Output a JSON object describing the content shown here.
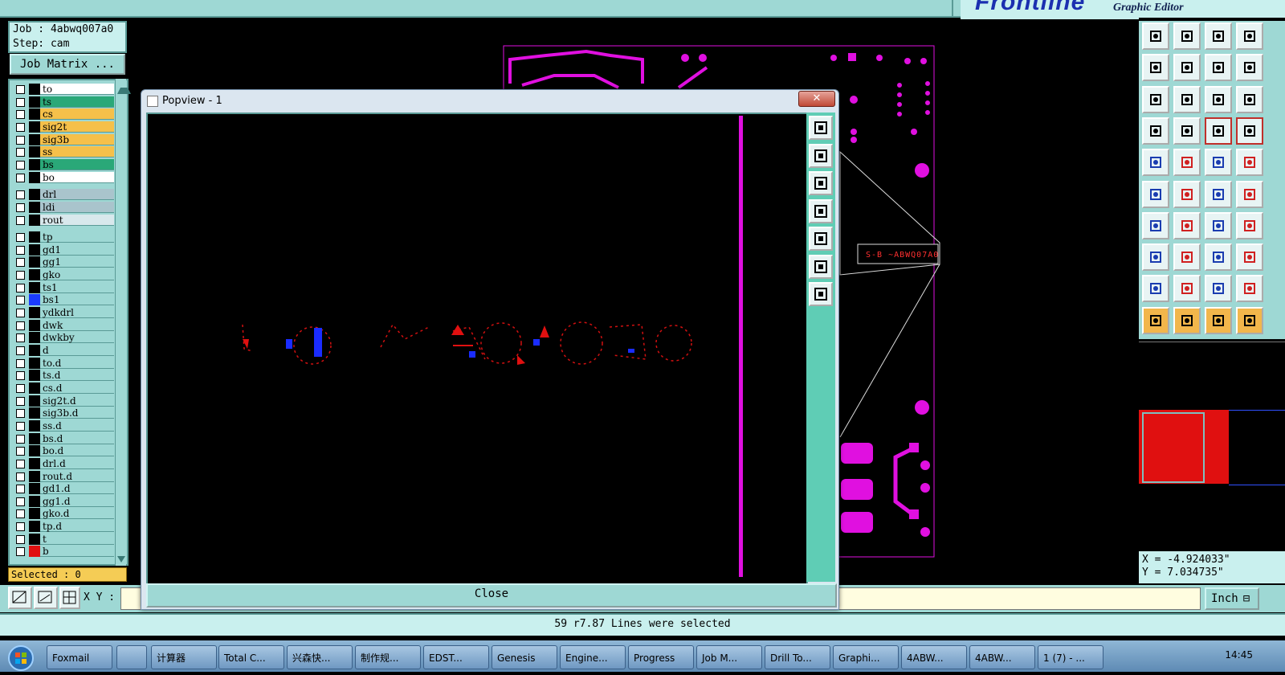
{
  "app": {
    "brand": "Frontline",
    "subtitle": "Graphic Editor"
  },
  "job": {
    "label": "Job : 4abwq007a0",
    "step": "Step: cam",
    "matrix_button": "Job Matrix ..."
  },
  "layers": [
    {
      "name": "to",
      "color": "#ffffff",
      "ind": "#000000"
    },
    {
      "name": "ts",
      "color": "#2aa878",
      "ind": "#000000"
    },
    {
      "name": "cs",
      "color": "#f5c04a",
      "ind": "#000000"
    },
    {
      "name": "sig2t",
      "color": "#f5c04a",
      "ind": "#000000"
    },
    {
      "name": "sig3b",
      "color": "#f5c04a",
      "ind": "#000000"
    },
    {
      "name": "ss",
      "color": "#f5c04a",
      "ind": "#000000"
    },
    {
      "name": "bs",
      "color": "#2aa878",
      "ind": "#000000"
    },
    {
      "name": "bo",
      "color": "#ffffff",
      "ind": "#000000"
    },
    {
      "name": "drl",
      "color": "#a9c4cc",
      "ind": "#000000"
    },
    {
      "name": "ldi",
      "color": "#a9c4cc",
      "ind": "#000000"
    },
    {
      "name": "rout",
      "color": "#d8e8ec",
      "ind": "#000000"
    },
    {
      "name": "tp",
      "color": "#9ed8d4",
      "ind": "#000000"
    },
    {
      "name": "gd1",
      "color": "#9ed8d4",
      "ind": "#000000"
    },
    {
      "name": "gg1",
      "color": "#9ed8d4",
      "ind": "#000000"
    },
    {
      "name": "gko",
      "color": "#9ed8d4",
      "ind": "#000000"
    },
    {
      "name": "ts1",
      "color": "#9ed8d4",
      "ind": "#000000"
    },
    {
      "name": "bs1",
      "color": "#9ed8d4",
      "ind": "#1a3cff"
    },
    {
      "name": "ydkdrl",
      "color": "#9ed8d4",
      "ind": "#000000"
    },
    {
      "name": "dwk",
      "color": "#9ed8d4",
      "ind": "#000000"
    },
    {
      "name": "dwkby",
      "color": "#9ed8d4",
      "ind": "#000000"
    },
    {
      "name": "d",
      "color": "#9ed8d4",
      "ind": "#000000"
    },
    {
      "name": "to.d",
      "color": "#9ed8d4",
      "ind": "#000000"
    },
    {
      "name": "ts.d",
      "color": "#9ed8d4",
      "ind": "#000000"
    },
    {
      "name": "cs.d",
      "color": "#9ed8d4",
      "ind": "#000000"
    },
    {
      "name": "sig2t.d",
      "color": "#9ed8d4",
      "ind": "#000000"
    },
    {
      "name": "sig3b.d",
      "color": "#9ed8d4",
      "ind": "#000000"
    },
    {
      "name": "ss.d",
      "color": "#9ed8d4",
      "ind": "#000000"
    },
    {
      "name": "bs.d",
      "color": "#9ed8d4",
      "ind": "#000000"
    },
    {
      "name": "bo.d",
      "color": "#9ed8d4",
      "ind": "#000000"
    },
    {
      "name": "drl.d",
      "color": "#9ed8d4",
      "ind": "#000000"
    },
    {
      "name": "rout.d",
      "color": "#9ed8d4",
      "ind": "#000000"
    },
    {
      "name": "gd1.d",
      "color": "#9ed8d4",
      "ind": "#000000"
    },
    {
      "name": "gg1.d",
      "color": "#9ed8d4",
      "ind": "#000000"
    },
    {
      "name": "gko.d",
      "color": "#9ed8d4",
      "ind": "#000000"
    },
    {
      "name": "tp.d",
      "color": "#9ed8d4",
      "ind": "#000000"
    },
    {
      "name": "t",
      "color": "#9ed8d4",
      "ind": "#000000"
    },
    {
      "name": "b",
      "color": "#9ed8d4",
      "ind": "#e01010"
    }
  ],
  "selected": "Selected : 0",
  "xy_label": "X Y :",
  "units": "Inch",
  "coords": {
    "x": "X = -4.924033\"",
    "y": "Y = 7.034735\""
  },
  "status": "59 r7.87 Lines were selected",
  "popup": {
    "title": "Popview - 1",
    "close_x": "✕",
    "close_label": "Close"
  },
  "taskbar": [
    {
      "label": "Foxmail"
    },
    {
      "label": ""
    },
    {
      "label": "计算器"
    },
    {
      "label": "Total C..."
    },
    {
      "label": "兴森快..."
    },
    {
      "label": "制作规..."
    },
    {
      "label": "EDST..."
    },
    {
      "label": "Genesis"
    },
    {
      "label": "Engine..."
    },
    {
      "label": "Progress"
    },
    {
      "label": "Job M..."
    },
    {
      "label": "Drill To..."
    },
    {
      "label": "Graphi..."
    },
    {
      "label": "4ABW..."
    },
    {
      "label": "4ABW..."
    },
    {
      "label": "1 (7) - ..."
    }
  ],
  "clock": "14:45"
}
